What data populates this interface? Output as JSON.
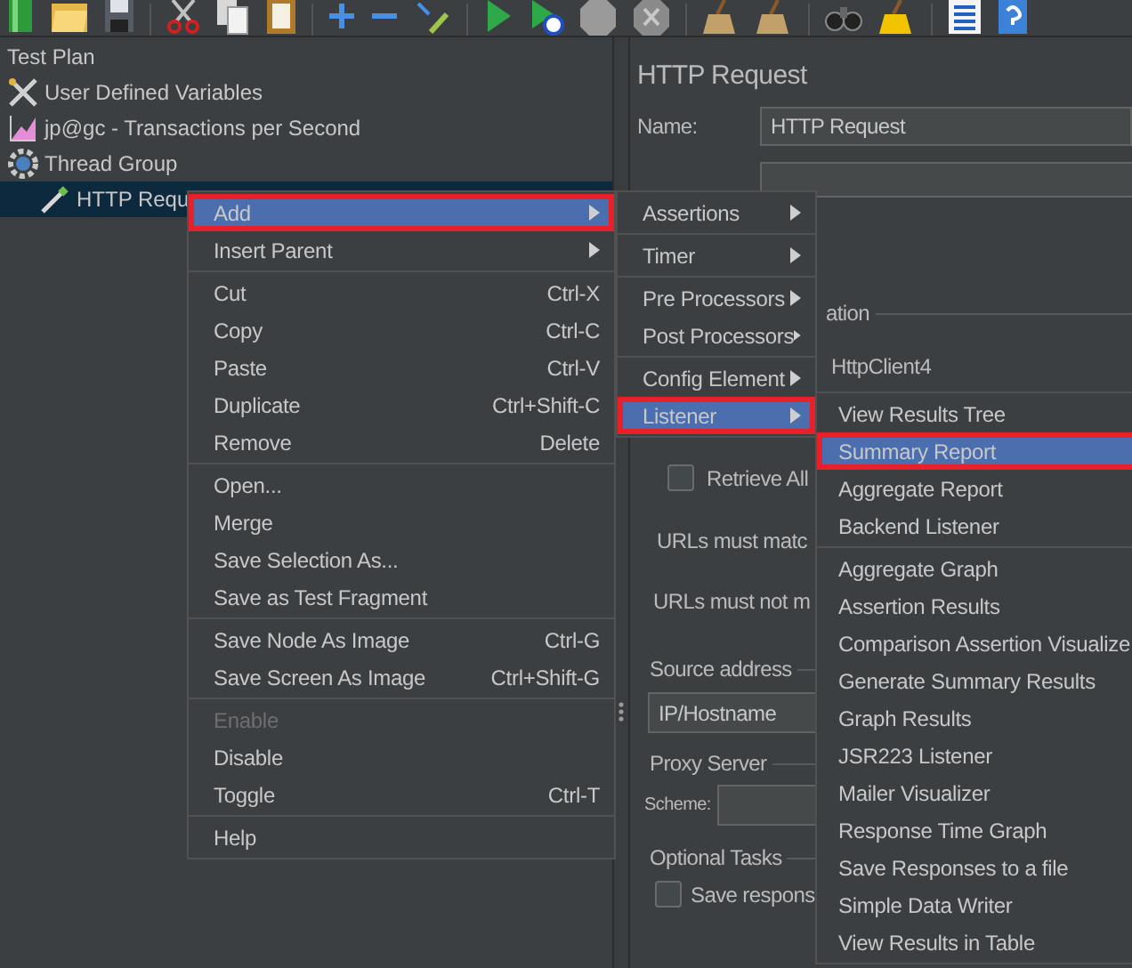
{
  "tree": [
    {
      "label": "Test Plan",
      "selected": false,
      "children": [
        {
          "label": "User Defined Variables",
          "kind": "config",
          "selected": false
        },
        {
          "label": "jp@gc - Transactions per Second",
          "kind": "listener",
          "selected": false
        },
        {
          "label": "Thread Group",
          "kind": "threads",
          "selected": false,
          "children": [
            {
              "label": "HTTP Requ",
              "kind": "sampler",
              "selected": true
            }
          ]
        }
      ]
    }
  ],
  "panel": {
    "title": "HTTP Request",
    "name_label": "Name:",
    "name_value": "HTTP Request",
    "implementation_legend": "ation",
    "implementation_value": "HttpClient4",
    "retrieve_all": {
      "label": "Retrieve All",
      "checked": false
    },
    "url_match_label": "URLs must matc",
    "url_not_match_label": "URLs must not m",
    "source_address": {
      "legend": "Source address",
      "value": "IP/Hostname"
    },
    "proxy_server": {
      "legend": "Proxy Server",
      "scheme_label": "Scheme:"
    },
    "optional_tasks": {
      "legend": "Optional Tasks",
      "save_responses": {
        "label": "Save respons",
        "checked": false
      }
    }
  },
  "menus": [
    {
      "items": [
        {
          "kind": "item",
          "label": "Add",
          "submenu": true,
          "selected": true
        },
        {
          "kind": "item",
          "label": "Insert Parent",
          "submenu": true,
          "selected": false
        },
        {
          "kind": "separator"
        },
        {
          "kind": "item",
          "label": "Cut",
          "shortcut": "Ctrl-X",
          "selected": false
        },
        {
          "kind": "item",
          "label": "Copy",
          "shortcut": "Ctrl-C",
          "selected": false
        },
        {
          "kind": "item",
          "label": "Paste",
          "shortcut": "Ctrl-V",
          "selected": false
        },
        {
          "kind": "item",
          "label": "Duplicate",
          "shortcut": "Ctrl+Shift-C",
          "selected": false
        },
        {
          "kind": "item",
          "label": "Remove",
          "shortcut": "Delete",
          "selected": false
        },
        {
          "kind": "separator"
        },
        {
          "kind": "item",
          "label": "Open...",
          "selected": false
        },
        {
          "kind": "item",
          "label": "Merge",
          "selected": false
        },
        {
          "kind": "item",
          "label": "Save Selection As...",
          "selected": false
        },
        {
          "kind": "item",
          "label": "Save as Test Fragment",
          "selected": false
        },
        {
          "kind": "separator"
        },
        {
          "kind": "item",
          "label": "Save Node As Image",
          "shortcut": "Ctrl-G",
          "selected": false
        },
        {
          "kind": "item",
          "label": "Save Screen As Image",
          "shortcut": "Ctrl+Shift-G",
          "selected": false
        },
        {
          "kind": "separator"
        },
        {
          "kind": "item",
          "label": "Enable",
          "disabled": true,
          "selected": false
        },
        {
          "kind": "item",
          "label": "Disable",
          "selected": false
        },
        {
          "kind": "item",
          "label": "Toggle",
          "shortcut": "Ctrl-T",
          "selected": false
        },
        {
          "kind": "separator"
        },
        {
          "kind": "item",
          "label": "Help",
          "selected": false
        }
      ]
    },
    {
      "items": [
        {
          "kind": "item",
          "label": "Assertions",
          "submenu": true,
          "selected": false
        },
        {
          "kind": "separator"
        },
        {
          "kind": "item",
          "label": "Timer",
          "submenu": true,
          "selected": false
        },
        {
          "kind": "separator"
        },
        {
          "kind": "item",
          "label": "Pre Processors",
          "submenu": true,
          "selected": false
        },
        {
          "kind": "item",
          "label": "Post Processors",
          "submenu": true,
          "selected": false
        },
        {
          "kind": "separator"
        },
        {
          "kind": "item",
          "label": "Config Element",
          "submenu": true,
          "selected": false
        },
        {
          "kind": "item",
          "label": "Listener",
          "submenu": true,
          "selected": true
        }
      ]
    },
    {
      "items": [
        {
          "kind": "item",
          "label": "View Results Tree",
          "selected": false
        },
        {
          "kind": "item",
          "label": "Summary Report",
          "selected": true
        },
        {
          "kind": "item",
          "label": "Aggregate Report",
          "selected": false
        },
        {
          "kind": "item",
          "label": "Backend Listener",
          "selected": false
        },
        {
          "kind": "separator"
        },
        {
          "kind": "item",
          "label": "Aggregate Graph",
          "selected": false
        },
        {
          "kind": "item",
          "label": "Assertion Results",
          "selected": false
        },
        {
          "kind": "item",
          "label": "Comparison Assertion Visualize",
          "selected": false
        },
        {
          "kind": "item",
          "label": "Generate Summary Results",
          "selected": false
        },
        {
          "kind": "item",
          "label": "Graph Results",
          "selected": false
        },
        {
          "kind": "item",
          "label": "JSR223 Listener",
          "selected": false
        },
        {
          "kind": "item",
          "label": "Mailer Visualizer",
          "selected": false
        },
        {
          "kind": "item",
          "label": "Response Time Graph",
          "selected": false
        },
        {
          "kind": "item",
          "label": "Save Responses to a file",
          "selected": false
        },
        {
          "kind": "item",
          "label": "Simple Data Writer",
          "selected": false
        },
        {
          "kind": "item",
          "label": "View Results in Table",
          "selected": false
        }
      ]
    }
  ]
}
